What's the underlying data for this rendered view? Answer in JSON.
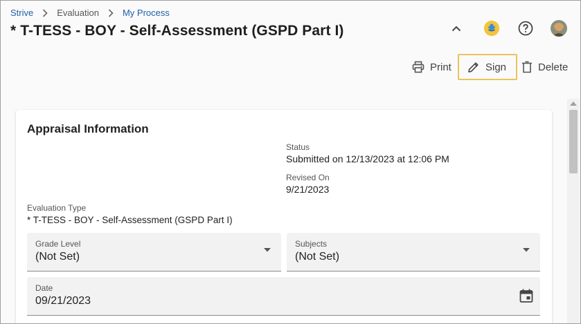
{
  "breadcrumb": {
    "items": [
      "Strive",
      "Evaluation",
      "My Process"
    ]
  },
  "page": {
    "title": "* T-TESS - BOY - Self-Assessment (GSPD Part I)"
  },
  "header_icons": [
    "chevron-up-icon",
    "app-badge-icon",
    "help-icon",
    "user-avatar"
  ],
  "toolbar": {
    "print_label": "Print",
    "sign_label": "Sign",
    "delete_label": "Delete"
  },
  "appraisal": {
    "section_title": "Appraisal Information",
    "status_label": "Status",
    "status_value": "Submitted on 12/13/2023 at 12:06 PM",
    "revised_label": "Revised On",
    "revised_value": "9/21/2023",
    "eval_type_label": "Evaluation Type",
    "eval_type_value": "* T-TESS - BOY - Self-Assessment (GSPD Part I)",
    "grade_level_label": "Grade Level",
    "grade_level_value": "(Not Set)",
    "subjects_label": "Subjects",
    "subjects_value": "(Not Set)",
    "date_label": "Date",
    "date_value": "09/21/2023"
  },
  "colors": {
    "link": "#1f5fa8",
    "sign_highlight": "#e8c45a",
    "field_bg": "#f2f2f2"
  }
}
